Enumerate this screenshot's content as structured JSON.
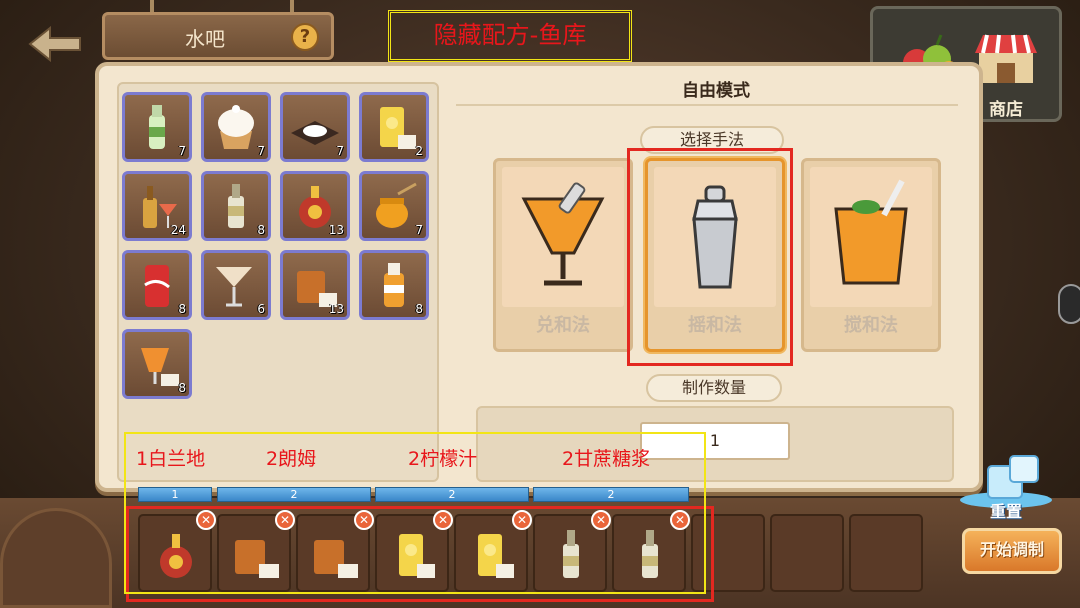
{
  "header": {
    "title": "水吧",
    "help_icon": "question-icon",
    "annotation": "隐藏配方-鱼库"
  },
  "shop": {
    "label": "商店"
  },
  "inventory": [
    {
      "name": "soda-bottle",
      "count": "7"
    },
    {
      "name": "cream-puff",
      "count": "7"
    },
    {
      "name": "sugar-plate",
      "count": "7"
    },
    {
      "name": "lemon-juice",
      "count": "2"
    },
    {
      "name": "cocktail-bottle",
      "count": "24"
    },
    {
      "name": "rum-bottle",
      "count": "8"
    },
    {
      "name": "brandy-bottle",
      "count": "13"
    },
    {
      "name": "honey-jar",
      "count": "7"
    },
    {
      "name": "cola-can",
      "count": "8"
    },
    {
      "name": "martini-glass",
      "count": "6"
    },
    {
      "name": "rum-glass",
      "count": "13"
    },
    {
      "name": "orange-juice-bottle",
      "count": "8"
    },
    {
      "name": "tropical-cocktail",
      "count": "8"
    }
  ],
  "right": {
    "mode_title": "自由模式",
    "select_label": "选择手法",
    "methods": [
      "兑和法",
      "摇和法",
      "搅和法"
    ],
    "count_label": "制作数量",
    "count_value": "1"
  },
  "annotations": [
    "1白兰地",
    "2朗姆",
    "2柠檬汁",
    "2甘蔗糖浆"
  ],
  "qty_bars": [
    "1",
    "2",
    "2",
    "2"
  ],
  "bottom_slots": [
    "brandy",
    "rum-glass",
    "rum-glass",
    "lemon-juice",
    "lemon-juice",
    "cane-syrup",
    "cane-syrup"
  ],
  "buttons": {
    "reset": "重置",
    "start": "开始调制"
  },
  "colors": {
    "annotation_red": "#e32820",
    "annotation_yellow": "#f2e516",
    "qty_blue": "#3a86c8"
  }
}
